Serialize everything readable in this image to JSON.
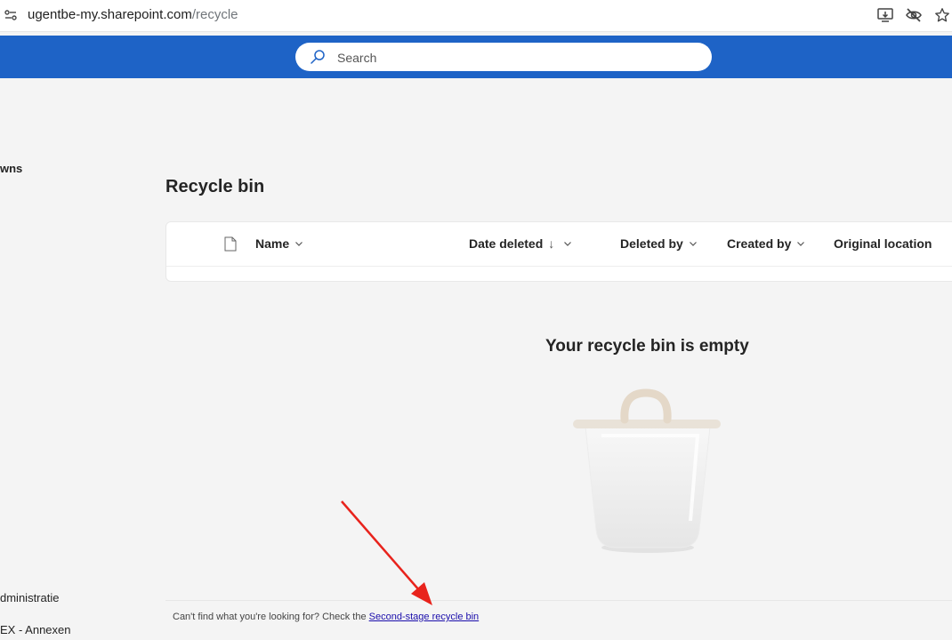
{
  "browser": {
    "url_host": "ugentbe-my.sharepoint.com",
    "url_path": "/recycle"
  },
  "suite": {
    "search_placeholder": "Search",
    "accent_color": "#1e63c6"
  },
  "nav": {
    "item_top": "wns",
    "item_admin": "dministratie",
    "item_annex": "EX - Annexen"
  },
  "page": {
    "title": "Recycle bin"
  },
  "table": {
    "columns": {
      "name": "Name",
      "date_deleted": "Date deleted",
      "date_deleted_sort": "↓",
      "deleted_by": "Deleted by",
      "created_by": "Created by",
      "original_location": "Original location"
    }
  },
  "empty_state": {
    "message": "Your recycle bin is empty"
  },
  "footer": {
    "prompt": "Can't find what you're looking for? Check the ",
    "link": "Second-stage recycle bin"
  },
  "annotation": {
    "arrow_color": "#e8231c"
  }
}
